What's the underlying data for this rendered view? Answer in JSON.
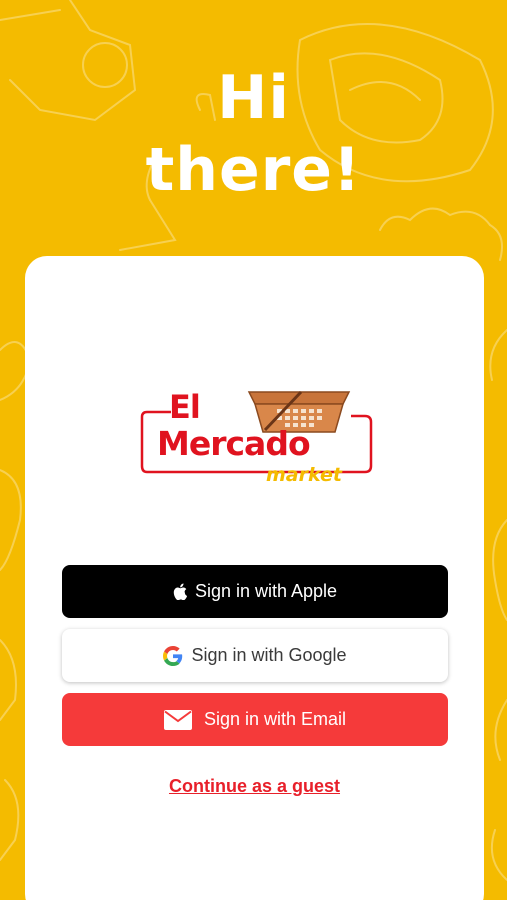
{
  "heading": {
    "line1": "Hi",
    "line2": "there!"
  },
  "logo": {
    "word1": "El",
    "word2": "Mercado",
    "word3": "market"
  },
  "buttons": {
    "apple": "Sign in with Apple",
    "google": "Sign in with Google",
    "email": "Sign in with Email"
  },
  "guest_link": "Continue as a guest",
  "colors": {
    "background": "#F4BB00",
    "brand_red": "#E0131F",
    "email_button": "#F53A3A",
    "apple_button": "#000000"
  },
  "icons": [
    "apple-icon",
    "google-icon",
    "mail-icon",
    "basket-icon"
  ]
}
